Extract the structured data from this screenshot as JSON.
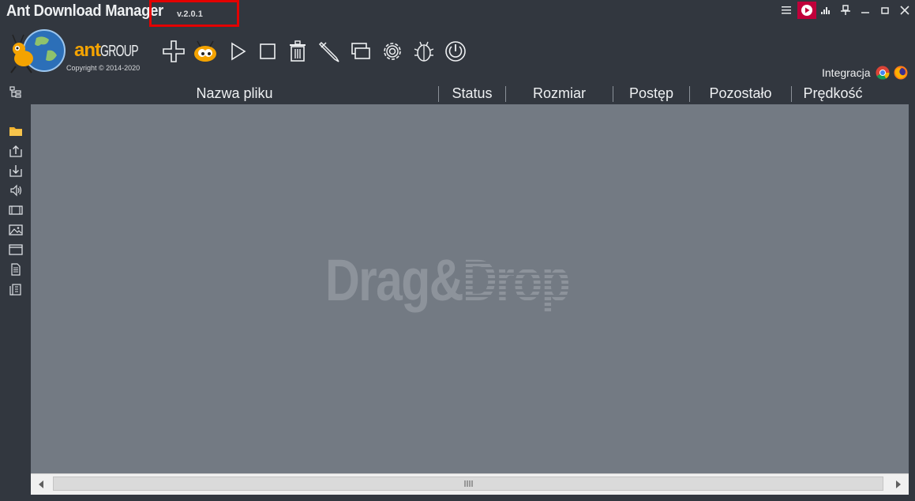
{
  "app": {
    "title": "Ant Download Manager",
    "version": "v.2.0.1"
  },
  "brand": {
    "name": "ant",
    "group": "GROUP",
    "copyright": "Copyright © 2014-2020"
  },
  "window_controls": [
    "menu-icon",
    "record-icon",
    "equalizer-icon",
    "pin-icon",
    "minimize-icon",
    "maximize-icon",
    "close-icon"
  ],
  "toolbar": {
    "buttons": [
      "add-icon",
      "ant-icon",
      "play-icon",
      "stop-icon",
      "trash-icon",
      "pen-icon",
      "windows-icon",
      "settings-icon",
      "bug-icon",
      "power-icon"
    ]
  },
  "integration": {
    "label": "Integracja",
    "browsers": [
      "chrome-icon",
      "firefox-icon"
    ]
  },
  "sidebar": {
    "items": [
      "tree-icon",
      "folder-icon",
      "upload-icon",
      "download-icon",
      "audio-icon",
      "video-icon",
      "image-icon",
      "window-icon",
      "document-icon",
      "archive-icon"
    ]
  },
  "columns": [
    "Nazwa pliku",
    "Status",
    "Rozmiar",
    "Postęp",
    "Pozostało",
    "Prędkość"
  ],
  "dropzone": {
    "drag": "Drag&",
    "drop": "Drop"
  },
  "colors": {
    "accent": "#e30000",
    "brand": "#f4a300",
    "background": "#32373f",
    "list": "#737a83"
  }
}
